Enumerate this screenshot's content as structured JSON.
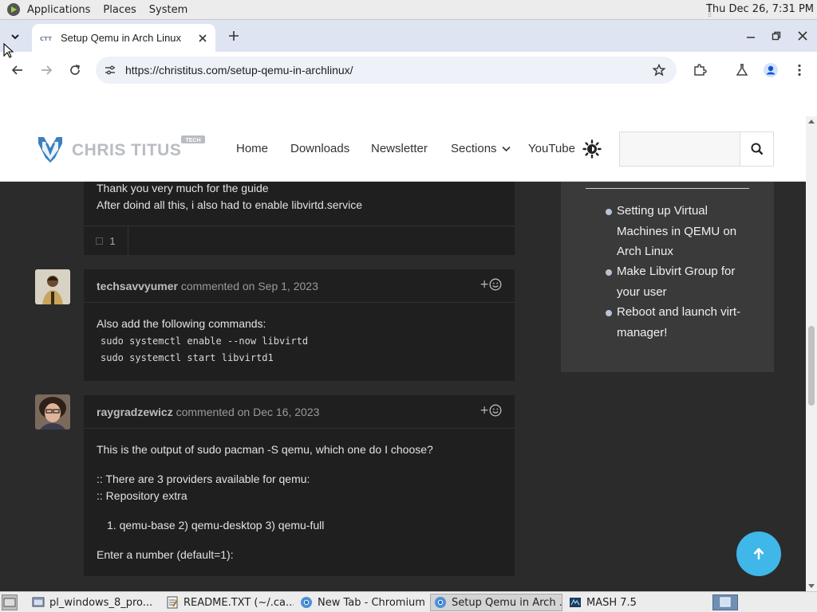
{
  "panel": {
    "applications": "Applications",
    "places": "Places",
    "system": "System",
    "clock": "Thu Dec 26,  7:31 PM"
  },
  "browser": {
    "tab_title": "Setup Qemu in Arch Linux",
    "url": "https://christitus.com/setup-qemu-in-archlinux/"
  },
  "site": {
    "logo_text": "CHRIS TITUS",
    "logo_badge": "TECH",
    "nav": [
      "Home",
      "Downloads",
      "Newsletter",
      "Sections",
      "YouTube"
    ],
    "search_placeholder": ""
  },
  "comments": [
    {
      "lines": [
        "Thank you very much for the guide",
        "After doind all this, i also had to enable libvirtd.service"
      ],
      "reaction_count": "1"
    },
    {
      "author": "techsavvyumer",
      "meta": "commented on Sep 1, 2023",
      "text": "Also add the following commands:",
      "code": [
        "sudo systemctl enable --now libvirtd",
        "sudo systemctl start libvirtd1"
      ]
    },
    {
      "author": "raygradzewicz",
      "meta": "commented on Dec 16, 2023",
      "lines": [
        "This is the output of sudo pacman -S qemu, which one do I choose?",
        ":: There are 3 providers available for qemu:",
        ":: Repository extra",
        "1. qemu-base 2) qemu-desktop 3) qemu-full",
        "Enter a number (default=1):"
      ]
    }
  ],
  "react_symbol": "+",
  "toc": [
    "Setting up Virtual Machines in QEMU on Arch Linux",
    "Make Libvirt Group for your user",
    "Reboot and launch virt-manager!"
  ],
  "taskbar": [
    "pl_windows_8_pro...",
    "README.TXT (~/.ca...",
    "New Tab - Chromium",
    "Setup Qemu in Arch ...",
    "MASH 7.5"
  ],
  "colors": {
    "accent_button": "#3fb7e8",
    "logo_blue": "#3a7fc1",
    "page_background": "#2b2b2b",
    "card_background": "#1f1f1f"
  },
  "icons": [
    "applications-icon",
    "tab-search-icon",
    "close-icon",
    "plus-icon",
    "back-icon",
    "forward-icon",
    "reload-icon",
    "site-info-icon",
    "star-icon",
    "extensions-icon",
    "labs-icon",
    "profile-icon",
    "menu-icon",
    "theme-toggle-icon",
    "search-icon",
    "smiley-icon",
    "arrow-up-icon"
  ]
}
